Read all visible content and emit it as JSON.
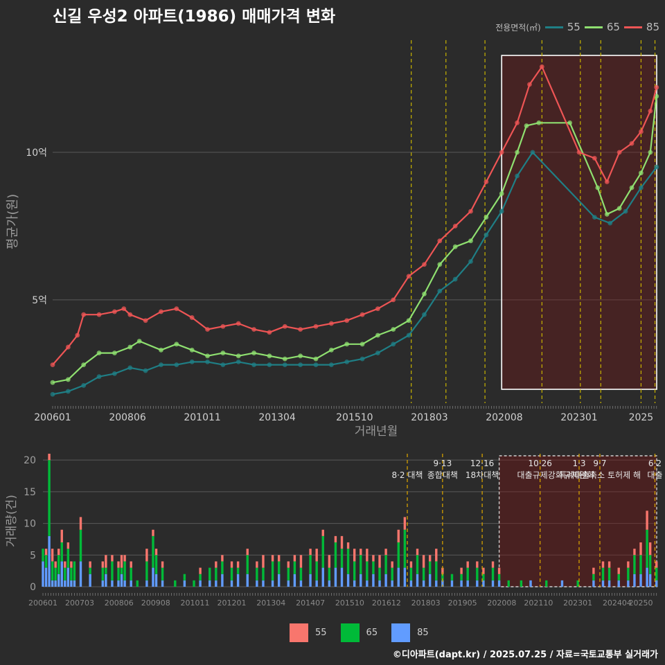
{
  "title": "신길 우성2 아파트(1986) 매매가격 변화",
  "legend_top": {
    "label": "전용면적(㎡)",
    "items": [
      {
        "name": "55",
        "color": "#1f7f86"
      },
      {
        "name": "65",
        "color": "#8fe070"
      },
      {
        "name": "85",
        "color": "#ee5555"
      }
    ]
  },
  "legend_bottom": {
    "items": [
      {
        "name": "55",
        "color": "#f8766d"
      },
      {
        "name": "65",
        "color": "#00ba38"
      },
      {
        "name": "85",
        "color": "#619cff"
      }
    ]
  },
  "footer": "©디아파트(dapt.kr) / 2025.07.25 / 자료=국토교통부 실거래가",
  "chart_data": [
    {
      "type": "line",
      "xlabel": "거래년월",
      "ylabel": "평균가(원)",
      "x_ticks": [
        "200601",
        "200806",
        "201011",
        "201304",
        "201510",
        "201803",
        "202008",
        "202301",
        "2025"
      ],
      "y_ticks": [
        {
          "value": 5,
          "label": "5억"
        },
        {
          "value": 10,
          "label": "10억"
        }
      ],
      "xlim": [
        2006.0,
        2025.55
      ],
      "ylim": [
        1.5,
        13.8
      ],
      "highlight_range": [
        2020.5,
        2025.55
      ],
      "policy_lines": [
        2017.58,
        2018.7,
        2019.96,
        2021.8,
        2023.04,
        2023.7,
        2025.0,
        2025.45
      ],
      "series": [
        {
          "name": "55",
          "color": "#1f7f86",
          "points": [
            [
              2006.0,
              1.8
            ],
            [
              2006.5,
              1.9
            ],
            [
              2007.0,
              2.1
            ],
            [
              2007.5,
              2.4
            ],
            [
              2008.0,
              2.5
            ],
            [
              2008.5,
              2.7
            ],
            [
              2009.0,
              2.6
            ],
            [
              2009.5,
              2.8
            ],
            [
              2010.0,
              2.8
            ],
            [
              2010.5,
              2.9
            ],
            [
              2011.0,
              2.9
            ],
            [
              2011.5,
              2.8
            ],
            [
              2012.0,
              2.9
            ],
            [
              2012.5,
              2.8
            ],
            [
              2013.0,
              2.8
            ],
            [
              2013.5,
              2.8
            ],
            [
              2014.0,
              2.8
            ],
            [
              2014.5,
              2.8
            ],
            [
              2015.0,
              2.8
            ],
            [
              2015.5,
              2.9
            ],
            [
              2016.0,
              3.0
            ],
            [
              2016.5,
              3.2
            ],
            [
              2017.0,
              3.5
            ],
            [
              2017.5,
              3.8
            ],
            [
              2018.0,
              4.5
            ],
            [
              2018.5,
              5.3
            ],
            [
              2019.0,
              5.7
            ],
            [
              2019.5,
              6.3
            ],
            [
              2020.0,
              7.2
            ],
            [
              2020.5,
              8.0
            ],
            [
              2021.0,
              9.2
            ],
            [
              2021.5,
              10.0
            ],
            [
              2023.5,
              7.8
            ],
            [
              2024.0,
              7.6
            ],
            [
              2024.5,
              8.0
            ],
            [
              2025.0,
              8.8
            ],
            [
              2025.5,
              9.5
            ]
          ]
        },
        {
          "name": "65",
          "color": "#8fe070",
          "points": [
            [
              2006.0,
              2.2
            ],
            [
              2006.5,
              2.3
            ],
            [
              2007.0,
              2.8
            ],
            [
              2007.5,
              3.2
            ],
            [
              2008.0,
              3.2
            ],
            [
              2008.5,
              3.4
            ],
            [
              2008.8,
              3.6
            ],
            [
              2009.5,
              3.3
            ],
            [
              2010.0,
              3.5
            ],
            [
              2010.5,
              3.3
            ],
            [
              2011.0,
              3.1
            ],
            [
              2011.5,
              3.2
            ],
            [
              2012.0,
              3.1
            ],
            [
              2012.5,
              3.2
            ],
            [
              2013.0,
              3.1
            ],
            [
              2013.5,
              3.0
            ],
            [
              2014.0,
              3.1
            ],
            [
              2014.5,
              3.0
            ],
            [
              2015.0,
              3.3
            ],
            [
              2015.5,
              3.5
            ],
            [
              2016.0,
              3.5
            ],
            [
              2016.5,
              3.8
            ],
            [
              2017.0,
              4.0
            ],
            [
              2017.5,
              4.3
            ],
            [
              2018.0,
              5.2
            ],
            [
              2018.5,
              6.2
            ],
            [
              2019.0,
              6.8
            ],
            [
              2019.5,
              7.0
            ],
            [
              2020.0,
              7.8
            ],
            [
              2020.5,
              8.6
            ],
            [
              2021.0,
              10.0
            ],
            [
              2021.3,
              10.9
            ],
            [
              2021.7,
              11.0
            ],
            [
              2022.7,
              11.0
            ],
            [
              2023.6,
              8.8
            ],
            [
              2023.9,
              7.9
            ],
            [
              2024.3,
              8.1
            ],
            [
              2024.7,
              8.8
            ],
            [
              2025.0,
              9.3
            ],
            [
              2025.3,
              10.0
            ],
            [
              2025.5,
              11.9
            ]
          ]
        },
        {
          "name": "85",
          "color": "#ee5555",
          "points": [
            [
              2006.0,
              2.8
            ],
            [
              2006.5,
              3.4
            ],
            [
              2006.8,
              3.8
            ],
            [
              2007.0,
              4.5
            ],
            [
              2007.5,
              4.5
            ],
            [
              2008.0,
              4.6
            ],
            [
              2008.3,
              4.7
            ],
            [
              2008.5,
              4.5
            ],
            [
              2009.0,
              4.3
            ],
            [
              2009.5,
              4.6
            ],
            [
              2010.0,
              4.7
            ],
            [
              2010.5,
              4.4
            ],
            [
              2011.0,
              4.0
            ],
            [
              2011.5,
              4.1
            ],
            [
              2012.0,
              4.2
            ],
            [
              2012.5,
              4.0
            ],
            [
              2013.0,
              3.9
            ],
            [
              2013.5,
              4.1
            ],
            [
              2014.0,
              4.0
            ],
            [
              2014.5,
              4.1
            ],
            [
              2015.0,
              4.2
            ],
            [
              2015.5,
              4.3
            ],
            [
              2016.0,
              4.5
            ],
            [
              2016.5,
              4.7
            ],
            [
              2017.0,
              5.0
            ],
            [
              2017.5,
              5.8
            ],
            [
              2018.0,
              6.2
            ],
            [
              2018.5,
              7.0
            ],
            [
              2019.0,
              7.5
            ],
            [
              2019.5,
              8.0
            ],
            [
              2020.0,
              9.0
            ],
            [
              2020.5,
              10.0
            ],
            [
              2021.0,
              11.0
            ],
            [
              2021.4,
              12.3
            ],
            [
              2021.8,
              12.9
            ],
            [
              2023.0,
              10.0
            ],
            [
              2023.5,
              9.8
            ],
            [
              2023.9,
              9.0
            ],
            [
              2024.3,
              10.0
            ],
            [
              2024.7,
              10.3
            ],
            [
              2025.0,
              10.7
            ],
            [
              2025.3,
              11.4
            ],
            [
              2025.5,
              12.2
            ]
          ]
        }
      ]
    },
    {
      "type": "bar",
      "stacked": true,
      "ylabel": "거래량(건)",
      "x_ticks": [
        "200601",
        "200703",
        "200806",
        "200908",
        "201011",
        "201201",
        "201304",
        "201407",
        "201510",
        "201612",
        "201803",
        "201905",
        "202008",
        "202110",
        "202301",
        "202404",
        "20250"
      ],
      "y_ticks": [
        0,
        5,
        10,
        15,
        20
      ],
      "xlim": [
        2006.0,
        2025.55
      ],
      "ylim": [
        0,
        21
      ],
      "highlight_range": [
        2020.5,
        2025.55
      ],
      "series_names": [
        "55",
        "65",
        "85"
      ],
      "bars": [
        [
          2006.0,
          0,
          2,
          4
        ],
        [
          2006.1,
          1,
          2,
          3
        ],
        [
          2006.2,
          1,
          12,
          8
        ],
        [
          2006.3,
          2,
          3,
          1
        ],
        [
          2006.4,
          1,
          2,
          1
        ],
        [
          2006.5,
          1,
          3,
          2
        ],
        [
          2006.6,
          2,
          3,
          4
        ],
        [
          2006.7,
          1,
          2,
          1
        ],
        [
          2006.8,
          1,
          3,
          3
        ],
        [
          2006.9,
          1,
          2,
          1
        ],
        [
          2007.0,
          0,
          3,
          1
        ],
        [
          2007.2,
          2,
          5,
          4
        ],
        [
          2007.5,
          1,
          1,
          2
        ],
        [
          2007.9,
          1,
          2,
          1
        ],
        [
          2008.0,
          2,
          1,
          2
        ],
        [
          2008.2,
          1,
          3,
          1
        ],
        [
          2008.4,
          1,
          2,
          1
        ],
        [
          2008.5,
          2,
          1,
          2
        ],
        [
          2008.6,
          1,
          3,
          1
        ],
        [
          2008.8,
          1,
          2,
          1
        ],
        [
          2009.0,
          0,
          1,
          0
        ],
        [
          2009.3,
          2,
          3,
          1
        ],
        [
          2009.5,
          1,
          5,
          3
        ],
        [
          2009.6,
          1,
          3,
          2
        ],
        [
          2009.8,
          1,
          2,
          1
        ],
        [
          2010.2,
          0,
          1,
          0
        ],
        [
          2010.5,
          0,
          1,
          1
        ],
        [
          2010.8,
          0,
          1,
          0
        ],
        [
          2011.0,
          1,
          1,
          1
        ],
        [
          2011.3,
          0,
          2,
          1
        ],
        [
          2011.5,
          1,
          2,
          1
        ],
        [
          2011.7,
          1,
          2,
          2
        ],
        [
          2012.0,
          1,
          2,
          1
        ],
        [
          2012.2,
          1,
          1,
          2
        ],
        [
          2012.5,
          1,
          3,
          2
        ],
        [
          2012.8,
          1,
          2,
          1
        ],
        [
          2013.0,
          2,
          2,
          1
        ],
        [
          2013.3,
          1,
          3,
          1
        ],
        [
          2013.5,
          1,
          2,
          2
        ],
        [
          2013.8,
          1,
          2,
          1
        ],
        [
          2014.0,
          1,
          2,
          2
        ],
        [
          2014.2,
          2,
          2,
          1
        ],
        [
          2014.5,
          1,
          3,
          2
        ],
        [
          2014.7,
          2,
          3,
          1
        ],
        [
          2014.9,
          1,
          5,
          3
        ],
        [
          2015.1,
          2,
          2,
          1
        ],
        [
          2015.3,
          1,
          4,
          3
        ],
        [
          2015.5,
          2,
          3,
          3
        ],
        [
          2015.7,
          1,
          4,
          2
        ],
        [
          2015.9,
          2,
          3,
          1
        ],
        [
          2016.1,
          1,
          3,
          2
        ],
        [
          2016.3,
          2,
          3,
          1
        ],
        [
          2016.5,
          1,
          2,
          2
        ],
        [
          2016.7,
          2,
          2,
          1
        ],
        [
          2016.9,
          1,
          3,
          2
        ],
        [
          2017.1,
          1,
          2,
          1
        ],
        [
          2017.3,
          2,
          4,
          3
        ],
        [
          2017.5,
          2,
          6,
          3
        ],
        [
          2017.7,
          1,
          2,
          1
        ],
        [
          2017.9,
          1,
          3,
          2
        ],
        [
          2018.1,
          2,
          2,
          1
        ],
        [
          2018.3,
          1,
          2,
          2
        ],
        [
          2018.5,
          2,
          3,
          1
        ],
        [
          2018.7,
          1,
          1,
          1
        ],
        [
          2019.0,
          0,
          1,
          1
        ],
        [
          2019.3,
          1,
          1,
          1
        ],
        [
          2019.5,
          1,
          2,
          1
        ],
        [
          2019.8,
          1,
          2,
          1
        ],
        [
          2020.0,
          1,
          1,
          1
        ],
        [
          2020.3,
          1,
          2,
          1
        ],
        [
          2020.5,
          1,
          1,
          1
        ],
        [
          2020.8,
          0,
          1,
          0
        ],
        [
          2021.2,
          0,
          1,
          0
        ],
        [
          2021.5,
          0,
          0,
          1
        ],
        [
          2022.0,
          0,
          1,
          0
        ],
        [
          2022.5,
          0,
          0,
          1
        ],
        [
          2023.0,
          0,
          1,
          0
        ],
        [
          2023.5,
          1,
          1,
          1
        ],
        [
          2023.8,
          1,
          2,
          1
        ],
        [
          2024.0,
          1,
          2,
          1
        ],
        [
          2024.3,
          1,
          1,
          1
        ],
        [
          2024.6,
          1,
          2,
          1
        ],
        [
          2024.8,
          1,
          3,
          2
        ],
        [
          2025.0,
          2,
          3,
          2
        ],
        [
          2025.2,
          3,
          6,
          3
        ],
        [
          2025.3,
          2,
          3,
          2
        ],
        [
          2025.5,
          1,
          2,
          1
        ]
      ],
      "policy_events": [
        {
          "x": 2017.58,
          "date": "",
          "label": "8·2 대책"
        },
        {
          "x": 2018.7,
          "date": "9·13",
          "label": "종합대책"
        },
        {
          "x": 2019.96,
          "date": "12·16",
          "label": "18차대책"
        },
        {
          "x": 2021.8,
          "date": "10·26",
          "label": "대출규제강화"
        },
        {
          "x": 2023.04,
          "date": "1·3",
          "label": "규제완화"
        },
        {
          "x": 2023.7,
          "date": "9·7",
          "label": "특례대출축소 토허제 해"
        },
        {
          "x": 2025.45,
          "date": "6·2",
          "label": "대출"
        }
      ]
    }
  ]
}
